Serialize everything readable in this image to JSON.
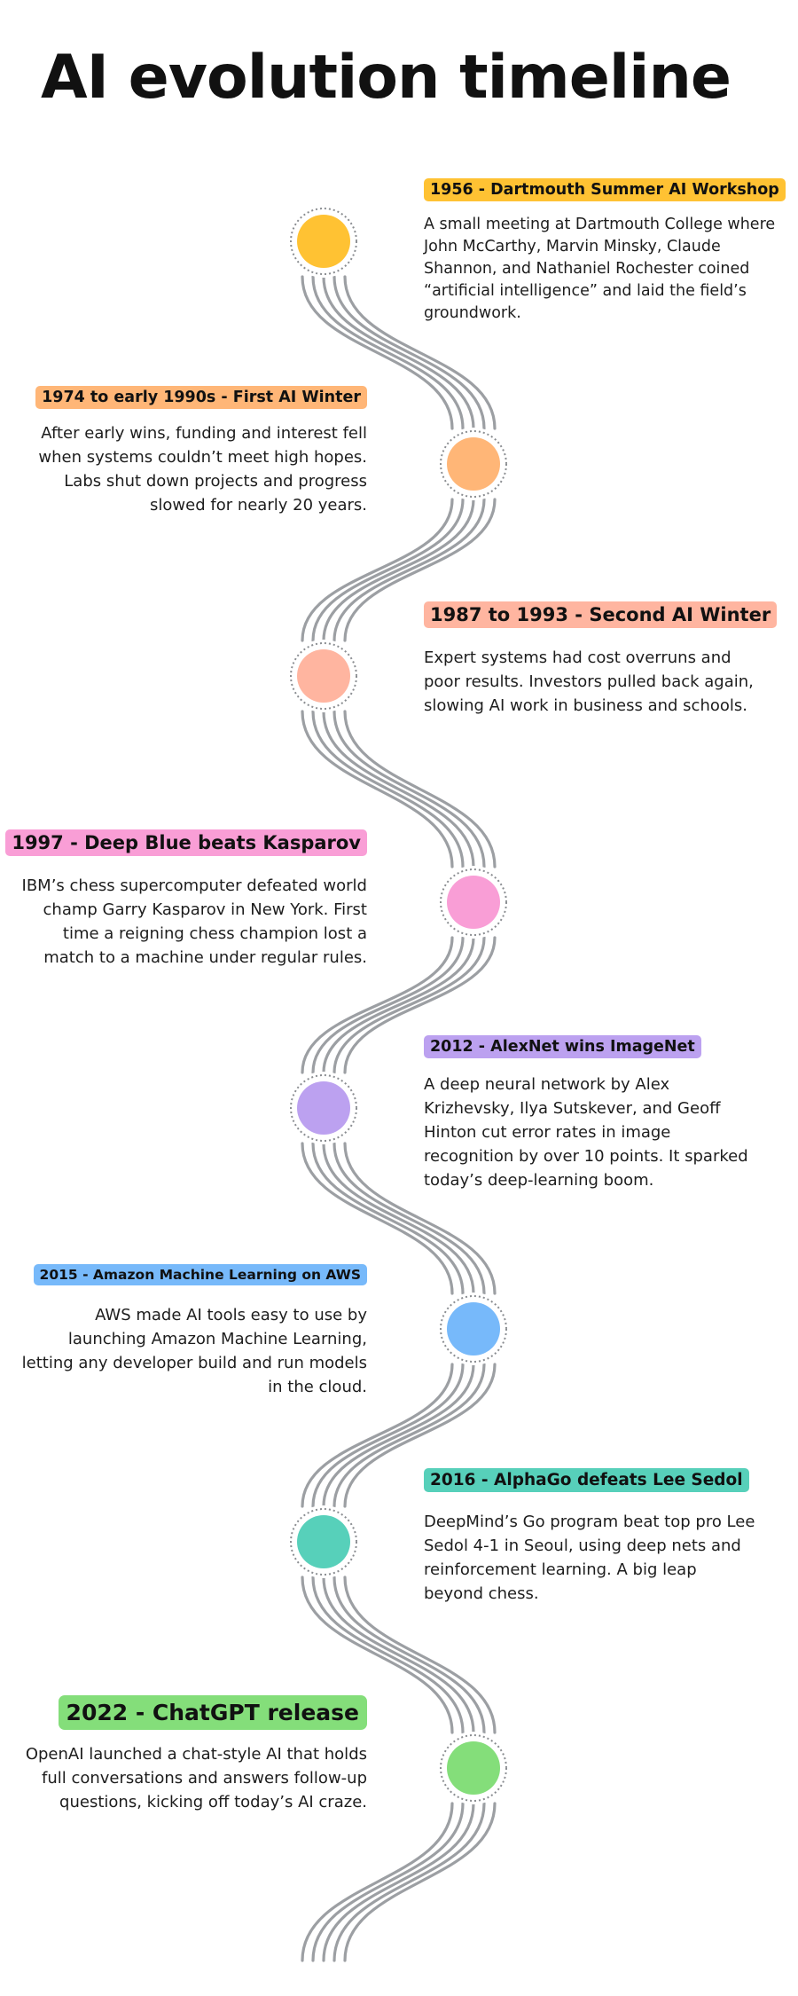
{
  "title": "AI evolution timeline",
  "events": [
    {
      "label": "1956 - Dartmouth Summer AI Workshop",
      "description": "A small meeting at Dartmouth College where John McCarthy, Marvin Minsky, Claude Shannon, and Nathaniel Rochester coined “artificial intelligence” and laid the field’s groundwork.",
      "color": "#FFC233"
    },
    {
      "label": "1974 to early 1990s -  First AI Winter",
      "description": "After early wins, funding and interest fell when systems couldn’t meet high hopes. Labs shut down projects and progress slowed for nearly 20 years.",
      "color": "#FFB677"
    },
    {
      "label": "1987 to 1993 - Second AI Winter",
      "description": "Expert systems had cost overruns and poor results. Investors pulled back again, slowing AI work in business and schools.",
      "color": "#FFB5A0"
    },
    {
      "label": "1997 - Deep Blue beats Kasparov",
      "description": "IBM’s chess supercomputer defeated world champ Garry Kasparov in New York. First time a reigning chess champion lost a match to a machine under regular rules.",
      "color": "#F99ED6"
    },
    {
      "label": "2012 - AlexNet wins ImageNet",
      "description": "A deep neural network by Alex Krizhevsky, Ilya Sutskever, and Geoff Hinton cut error rates in image recognition by over 10 points. It sparked today’s deep-learning boom.",
      "color": "#BCA1F0"
    },
    {
      "label": "2015 - Amazon Machine Learning on AWS",
      "description": "AWS made AI tools easy to use by launching Amazon Machine Learning, letting any developer build and run models in the cloud.",
      "color": "#77B9FA"
    },
    {
      "label": "2016 - AlphaGo defeats Lee Sedol",
      "description": "DeepMind’s Go program beat top pro Lee Sedol 4-1 in Seoul, using deep nets and reinforcement learning. A big leap beyond chess.",
      "color": "#57D0BA"
    },
    {
      "label": "2022 - ChatGPT release",
      "description": "OpenAI launched a chat-style AI that holds full conversations and answers follow-up questions, kicking off today’s AI craze.",
      "color": "#84DE7A"
    }
  ]
}
